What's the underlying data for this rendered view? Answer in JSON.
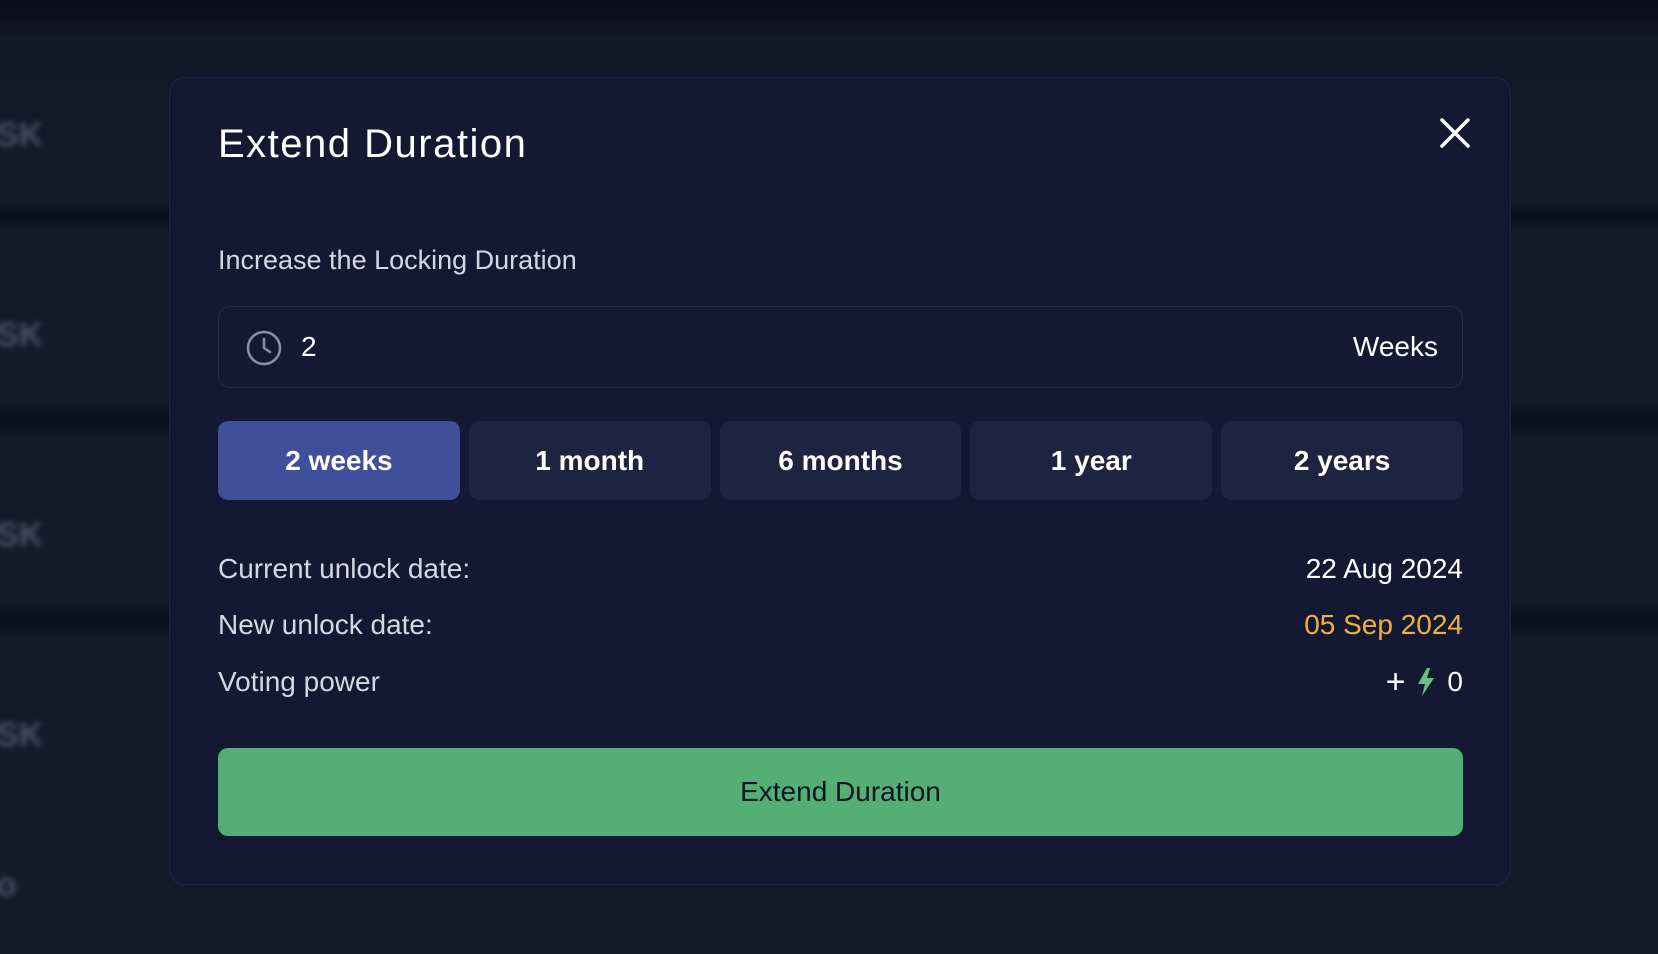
{
  "background": {
    "row_labels": [
      "SK",
      "SK",
      "SK",
      "SK",
      "o"
    ]
  },
  "modal": {
    "title": "Extend Duration",
    "close_icon": "close-icon",
    "subtitle": "Increase the Locking Duration",
    "duration_input": {
      "icon": "clock-icon",
      "value": "2",
      "unit": "Weeks"
    },
    "presets": [
      {
        "label": "2 weeks",
        "active": true
      },
      {
        "label": "1 month",
        "active": false
      },
      {
        "label": "6 months",
        "active": false
      },
      {
        "label": "1 year",
        "active": false
      },
      {
        "label": "2 years",
        "active": false
      }
    ],
    "current_unlock": {
      "label": "Current unlock date:",
      "value": "22 Aug 2024"
    },
    "new_unlock": {
      "label": "New unlock date:",
      "value": "05 Sep 2024"
    },
    "voting_power": {
      "label": "Voting power",
      "prefix": "+",
      "icon": "bolt-icon",
      "value": "0"
    },
    "submit_label": "Extend Duration"
  },
  "colors": {
    "background": "#141a2b",
    "modal": "#131933",
    "preset_active": "#3f4f9a",
    "preset_inactive": "#1d2440",
    "highlight": "#f0b03c",
    "submit": "#55ae73"
  }
}
